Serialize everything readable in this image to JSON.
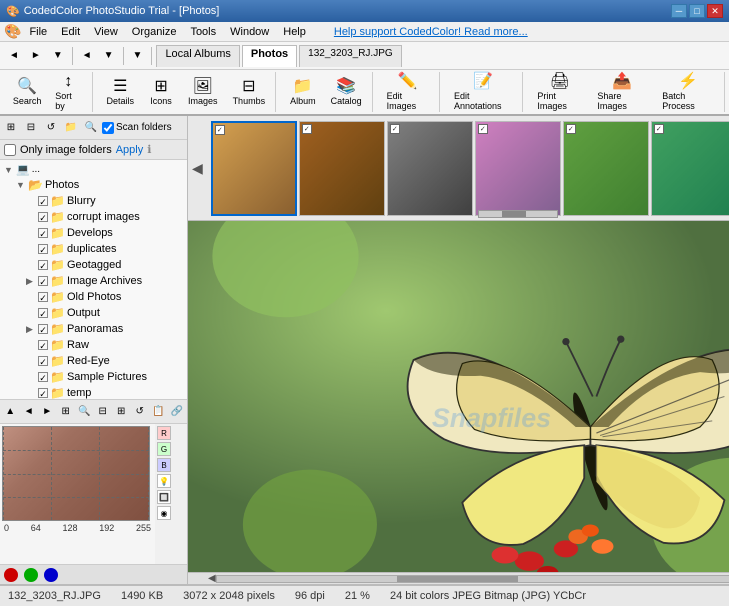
{
  "titleBar": {
    "appName": "CodedColor PhotoStudio Trial - [Photos]",
    "icon": "🎨"
  },
  "menuBar": {
    "items": [
      "File",
      "Edit",
      "View",
      "Organize",
      "Tools",
      "Window",
      "Help"
    ],
    "helpLink": "Help support CodedColor! Read more..."
  },
  "toolbar1": {
    "backLabel": "◄",
    "forwardLabel": "►",
    "localAlbums": "Local Albums",
    "photos": "Photos",
    "currentFile": "132_3203_RJ.JPG"
  },
  "toolbar2": {
    "search": "Search",
    "sortBy": "Sort by",
    "details": "Details",
    "icons": "Icons",
    "images": "Images",
    "thumbs": "Thumbs",
    "album": "Album",
    "catalog": "Catalog",
    "editImages": "Edit Images",
    "editAnnotations": "Edit Annotations",
    "printImages": "Print Images",
    "shareImages": "Share Images",
    "batchProcess": "Batch Process"
  },
  "folderOptions": {
    "scanFolders": "Scan folders",
    "onlyImageFolders": "Only image folders",
    "apply": "Apply"
  },
  "folderTree": {
    "root": "Photos",
    "items": [
      {
        "label": "Blurry",
        "indent": 2
      },
      {
        "label": "corrupt images",
        "indent": 2
      },
      {
        "label": "Develops",
        "indent": 2
      },
      {
        "label": "duplicates",
        "indent": 2
      },
      {
        "label": "Geotagged",
        "indent": 2
      },
      {
        "label": "Image Archives",
        "indent": 2,
        "hasChildren": true
      },
      {
        "label": "Old Photos",
        "indent": 2
      },
      {
        "label": "Output",
        "indent": 2
      },
      {
        "label": "Panoramas",
        "indent": 2,
        "hasChildren": true
      },
      {
        "label": "Raw",
        "indent": 2
      },
      {
        "label": "Red-Eye",
        "indent": 2
      },
      {
        "label": "Sample Pictures",
        "indent": 2
      },
      {
        "label": "temp",
        "indent": 2
      }
    ]
  },
  "histogram": {
    "axisLabels": [
      "0",
      "64",
      "128",
      "192",
      "255"
    ]
  },
  "statusBar": {
    "filename": "132_3203_RJ.JPG",
    "filesize": "1490 KB",
    "dimensions": "3072 x 2048 pixels",
    "dpi": "96 dpi",
    "zoom": "21 %",
    "colorInfo": "24 bit colors JPEG Bitmap (JPG) YCbCr"
  },
  "thumbnails": [
    {
      "type": "butterfly",
      "selected": true
    },
    {
      "type": "butterfly2",
      "selected": false
    },
    {
      "type": "door",
      "selected": false
    },
    {
      "type": "flower",
      "selected": false
    },
    {
      "type": "leaves",
      "selected": false
    },
    {
      "type": "bird",
      "selected": false
    },
    {
      "type": "unknown",
      "selected": false
    }
  ],
  "watermark": "Snapfiles"
}
